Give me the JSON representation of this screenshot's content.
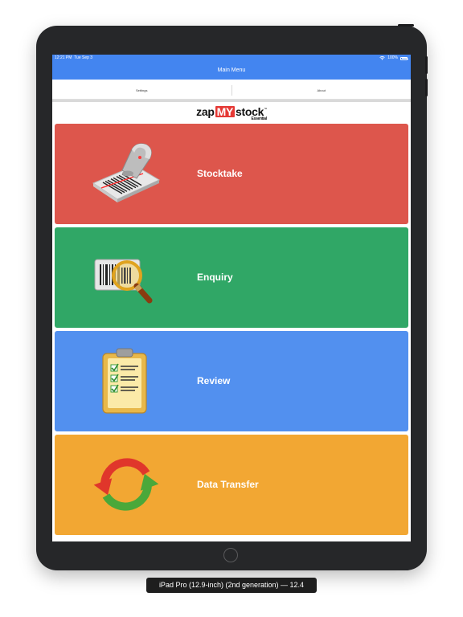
{
  "status_bar": {
    "time": "12:21 PM",
    "date": "Tue Sep 3",
    "battery": "100%"
  },
  "nav_bar": {
    "title": "Main Menu"
  },
  "segments": [
    {
      "label": "Settings"
    },
    {
      "label": "About"
    }
  ],
  "logo": {
    "zap": "zap",
    "my": "MY",
    "stock": "stock",
    "tm": "™",
    "sub": "Essential"
  },
  "tiles": [
    {
      "label": "Stocktake",
      "color": "#dd564c",
      "icon": "barcode-scanner-icon"
    },
    {
      "label": "Enquiry",
      "color": "#30a766",
      "icon": "barcode-magnifier-icon"
    },
    {
      "label": "Review",
      "color": "#5290ef",
      "icon": "clipboard-checklist-icon"
    },
    {
      "label": "Data Transfer",
      "color": "#f2a733",
      "icon": "sync-arrows-icon"
    }
  ],
  "caption": "iPad Pro (12.9-inch) (2nd generation) — 12.4"
}
